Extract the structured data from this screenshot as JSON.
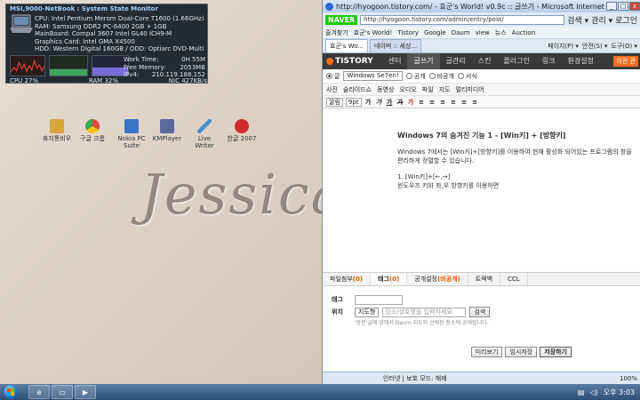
{
  "desktop": {
    "wallpaper_text": "Jessica",
    "icons": [
      {
        "label": "휴지통비우",
        "color": "#d9a53b"
      },
      {
        "label": "구글 크롬",
        "color": "#e04a3a"
      },
      {
        "label": "Nokia PC Suite",
        "color": "#3a74c8"
      },
      {
        "label": "KMPlayer",
        "color": "#5a6a9a"
      },
      {
        "label": "Live Writer",
        "color": "#4a90d0"
      },
      {
        "label": "한글 2007",
        "color": "#d12b2b"
      }
    ]
  },
  "sysmon": {
    "title": "MSI,9000-NetBook : System State Monitor",
    "cpu": "CPU: Intel Pentium Merom Dual-Core T1600 (1.66GHz)",
    "ram": "RAM: Samsung DDR2 PC-6400 2GB + 1GB",
    "mainboard": "MainBoard: Compal 3607 Intel GL40 ICH9-M",
    "graphics": "Graphics Card: Intel GMA X4500",
    "hdd": "HDD: Western Digital 160GB / ODD: Optiarc DVD-Multi",
    "work_time_label": "Work Time:",
    "work_time": "0H 55M",
    "free_mem_label": "Free Memory:",
    "free_mem": "2053MB",
    "ipv4_label": "IPv4:",
    "ipv4": "210.119.188.152",
    "cpu_usage": "CPU 27%",
    "ram_usage": "RAM 32%",
    "nic": "NIC 427KB/s"
  },
  "ie": {
    "title": "http://hyogoon.tistory.com/ - 효군's World! v0.9c :: 글쓰기 - Microsoft Internet Explorer",
    "addr_brand": "NAVER",
    "url": "http://hyogoon.tistory.com/admin/entry/post/",
    "search_label": "검색 ▾",
    "manage_label": "관리 ▾",
    "login_label": "로그인",
    "favorites": [
      "즐겨찾기",
      "효군's World!",
      "Tistory",
      "Google",
      "Daum",
      "view",
      "뉴스",
      "Auction"
    ],
    "tabs": [
      {
        "label": "효군's Wo...",
        "active": true
      },
      {
        "label": "네이버 :: 세상...",
        "active": false
      }
    ],
    "commands": [
      "페이지(P) ▾",
      "안전(S) ▾",
      "도구(O) ▾"
    ],
    "status_text": "인터넷 | 보호 모드: 해제",
    "zoom": "100%"
  },
  "tistory": {
    "logo": "TISTORY",
    "menu": [
      "센터",
      "글쓰기",
      "글관리",
      "스킨",
      "플러그인",
      "링크",
      "환경설정"
    ],
    "active_menu": "글쓰기",
    "back_label": "이전 관",
    "category_label": "글",
    "category_value": "Windows Se7en!",
    "visibility": [
      "공개",
      "비공개",
      "서식"
    ],
    "attach": [
      "사진",
      "슬라이드쇼",
      "동영상",
      "오디오",
      "파일",
      "지도",
      "멀티미디어"
    ],
    "font_select": "굴림",
    "size_select": "9pt",
    "toolbar": [
      "가",
      "가",
      "가",
      "가",
      "가",
      "≡",
      "≡",
      "≡",
      "≡",
      "≡",
      "≡"
    ],
    "post": {
      "title": "Windows 7의 숨겨진 기능 1 - [Win키] + [방향키]",
      "paragraph1": "Windows 7에서는 [Win키]+[방향키]를 이용하여 현재 활성화 되어있는 프로그램의 창을 편리하게 정렬할 수 있습니다.",
      "paragraph2a": "1. [Win키]+[←,→]",
      "paragraph2b": "윈도우즈 키와 좌,우 방향키를 이용하면"
    },
    "meta_tabs": [
      {
        "label": "파일첨부",
        "count": "(0)",
        "active": false
      },
      {
        "label": "태그",
        "count": "(0)",
        "active": true
      },
      {
        "label": "공개설정",
        "count": "(비공개)",
        "active": false
      },
      {
        "label": "트랙백",
        "count": "",
        "active": false
      },
      {
        "label": "CCL",
        "count": "",
        "active": false
      }
    ],
    "tag_label": "태그",
    "location_label": "위치",
    "location_select": "지도형",
    "location_placeholder": "장소/상호명을 입력하세요.",
    "search_button": "검색",
    "location_note": "'방문'글에 위해서 Daum 지도의 선택된 장소에 공개됩니다.",
    "preview_button": "미리보기",
    "draft_button": "임시저장",
    "save_button": "저장하기"
  },
  "taskbar": {
    "lang": "",
    "time": "오후 3:03"
  }
}
